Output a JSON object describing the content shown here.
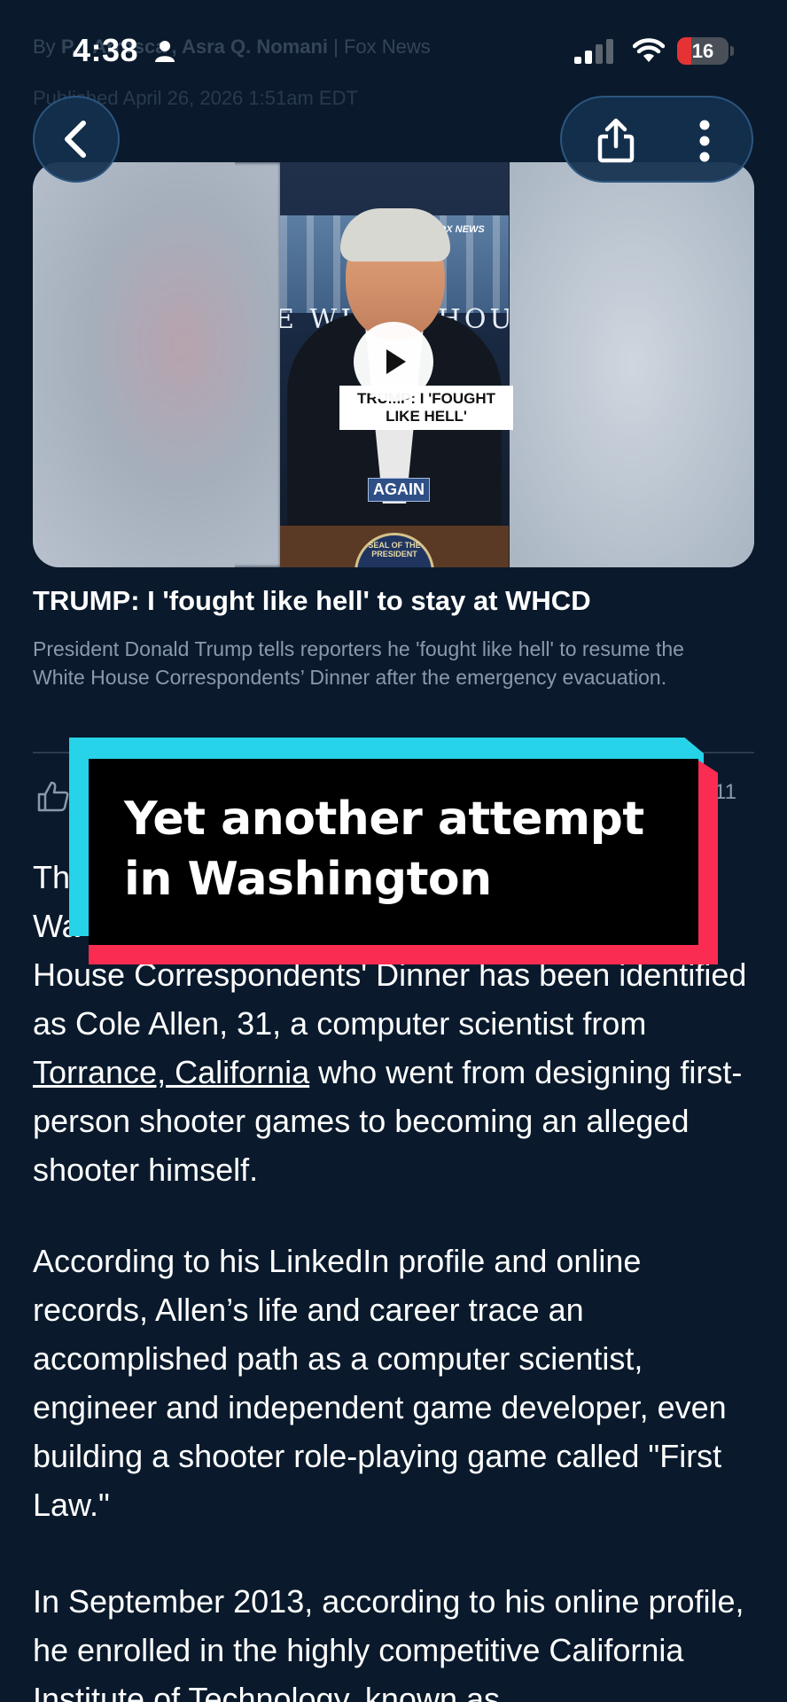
{
  "article_meta": {
    "byline_prefix": "By",
    "authors": "P... Arrosca , Asra Q. Nomani",
    "separator": "|",
    "source": "Fox News",
    "published": "Published April 26, 2026 1:51am EDT"
  },
  "status_bar": {
    "time": "4:38",
    "battery": "16",
    "battery_level": 0.16
  },
  "video": {
    "caption_text": "TRUMP: I 'FOUGHT LIKE HELL'",
    "again_tag": "AGAIN",
    "backdrop_text": "E WHITE HOUSE",
    "fox_mark": "FOX NEWS",
    "seal_text": "SEAL OF THE PRESIDENT"
  },
  "headline": "TRUMP: I 'fought like hell' to stay at WHCD",
  "summary": "President Donald Trump tells reporters he 'fought like hell' to resume the White House Correspondents’ Dinner after the emergency evacuation.",
  "reactions": {
    "count": "11"
  },
  "overlay_banner": "Yet another attempt in Washington",
  "body": {
    "p1_start": "The",
    "p1_line2_start": "Wa",
    "p1_line3": "House Correspondents' Dinner has been identified as Cole Allen, 31, a computer scientist from",
    "p1_link": "Torrance, California",
    "p1_end": "who went from designing first-person shooter games to becoming an alleged shooter himself.",
    "p2": "According to his LinkedIn profile and online records, Allen’s life and career trace an accomplished path as a computer scientist, engineer and independent game developer, even building a shooter role-playing game called \"First Law.\"",
    "p3": "In September 2013, according to his online profile, he enrolled in the highly competitive California Institute of Technology, known as"
  },
  "icons": {
    "back": "chevron-left-icon",
    "share": "share-icon",
    "more": "more-vertical-icon",
    "play": "play-icon",
    "like": "thumbs-up-icon",
    "signal": "cellular-signal-icon",
    "wifi": "wifi-icon",
    "person": "person-icon"
  },
  "colors": {
    "background": "#0a1a2c",
    "banner_cyan": "#27d3e8",
    "banner_red": "#fb2c52",
    "battery_low": "#e53335"
  }
}
